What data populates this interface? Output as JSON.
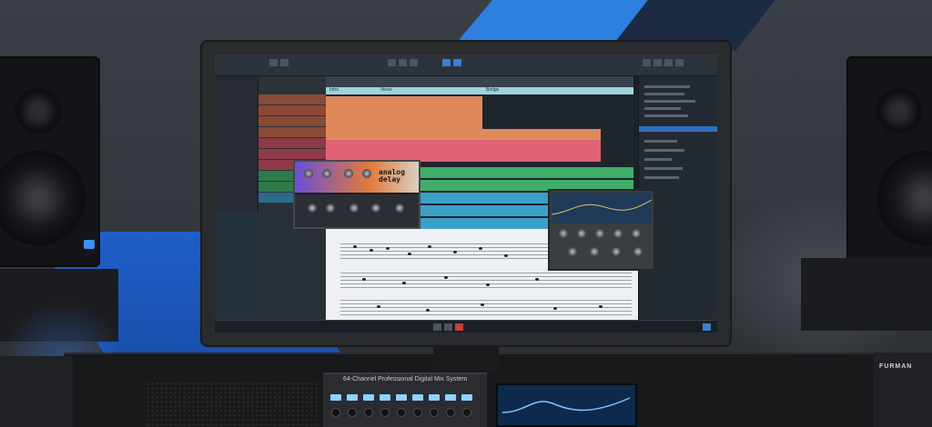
{
  "scene": {
    "mixer_label": "64-Channel Professional Digital Mix System",
    "rack_brand": "FURMAN",
    "accent_blue": "#2d7fe0"
  },
  "daw": {
    "plugin_name": "analog delay",
    "marker_labels": [
      "Intro",
      "Verse",
      "Bridge"
    ]
  }
}
